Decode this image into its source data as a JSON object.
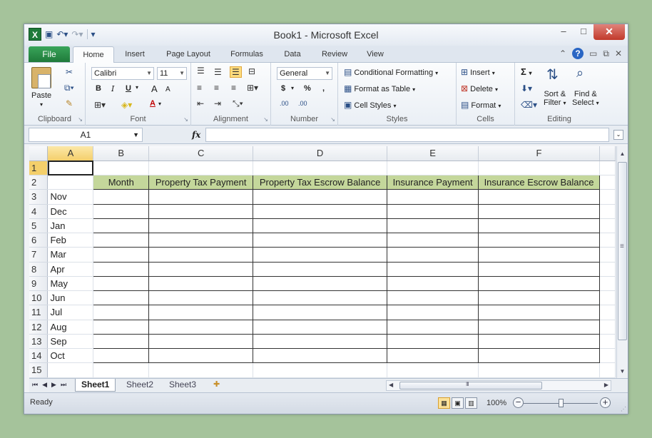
{
  "window": {
    "title": "Book1 - Microsoft Excel",
    "app_icon": "excel-icon",
    "minimize": "–",
    "restore": "□",
    "close": "✕"
  },
  "ribbon_tabs": [
    "File",
    "Home",
    "Insert",
    "Page Layout",
    "Formulas",
    "Data",
    "Review",
    "View"
  ],
  "active_tab": "Home",
  "ribbon": {
    "clipboard": {
      "paste_label": "Paste",
      "group_label": "Clipboard"
    },
    "font": {
      "font_name": "Calibri",
      "font_size": "11",
      "bold": "B",
      "italic": "I",
      "underline": "U",
      "grow": "A",
      "shrink": "A",
      "font_color": "A",
      "group_label": "Font"
    },
    "alignment": {
      "group_label": "Alignment"
    },
    "number": {
      "format": "General",
      "currency": "$",
      "percent": "%",
      "comma": ",",
      "inc_decimal": ".00",
      "dec_decimal": ".00",
      "group_label": "Number"
    },
    "styles": {
      "conditional": "Conditional Formatting",
      "format_table": "Format as Table",
      "cell_styles": "Cell Styles",
      "group_label": "Styles"
    },
    "cells": {
      "insert": "Insert",
      "delete": "Delete",
      "format": "Format",
      "group_label": "Cells"
    },
    "editing": {
      "sigma": "Σ",
      "sort_line1": "Sort &",
      "sort_line2": "Filter",
      "find_line1": "Find &",
      "find_line2": "Select",
      "group_label": "Editing"
    }
  },
  "formula_bar": {
    "name_box": "A1",
    "fx": "fx",
    "formula": ""
  },
  "grid": {
    "columns": [
      "A",
      "B",
      "C",
      "D",
      "E",
      "F"
    ],
    "selected_column": "A",
    "rows": [
      {
        "n": "1",
        "cells": [
          "",
          "",
          "",
          "",
          "",
          ""
        ]
      },
      {
        "n": "2",
        "cells": [
          "",
          "Month",
          "Property Tax Payment",
          "Property Tax Escrow Balance",
          "Insurance Payment",
          "Insurance Escrow Balance"
        ]
      },
      {
        "n": "3",
        "cells": [
          "Nov",
          "",
          "",
          "",
          "",
          ""
        ]
      },
      {
        "n": "4",
        "cells": [
          "Dec",
          "",
          "",
          "",
          "",
          ""
        ]
      },
      {
        "n": "5",
        "cells": [
          "Jan",
          "",
          "",
          "",
          "",
          ""
        ]
      },
      {
        "n": "6",
        "cells": [
          "Feb",
          "",
          "",
          "",
          "",
          ""
        ]
      },
      {
        "n": "7",
        "cells": [
          "Mar",
          "",
          "",
          "",
          "",
          ""
        ]
      },
      {
        "n": "8",
        "cells": [
          "Apr",
          "",
          "",
          "",
          "",
          ""
        ]
      },
      {
        "n": "9",
        "cells": [
          "May",
          "",
          "",
          "",
          "",
          ""
        ]
      },
      {
        "n": "10",
        "cells": [
          "Jun",
          "",
          "",
          "",
          "",
          ""
        ]
      },
      {
        "n": "11",
        "cells": [
          "Jul",
          "",
          "",
          "",
          "",
          ""
        ]
      },
      {
        "n": "12",
        "cells": [
          "Aug",
          "",
          "",
          "",
          "",
          ""
        ]
      },
      {
        "n": "13",
        "cells": [
          "Sep",
          "",
          "",
          "",
          "",
          ""
        ]
      },
      {
        "n": "14",
        "cells": [
          "Oct",
          "",
          "",
          "",
          "",
          ""
        ]
      },
      {
        "n": "15",
        "cells": [
          "",
          "",
          "",
          "",
          "",
          ""
        ]
      }
    ],
    "header_fill": "#c4d79b"
  },
  "sheet_tabs": [
    "Sheet1",
    "Sheet2",
    "Sheet3"
  ],
  "active_sheet": "Sheet1",
  "status": {
    "text": "Ready",
    "zoom": "100%"
  }
}
